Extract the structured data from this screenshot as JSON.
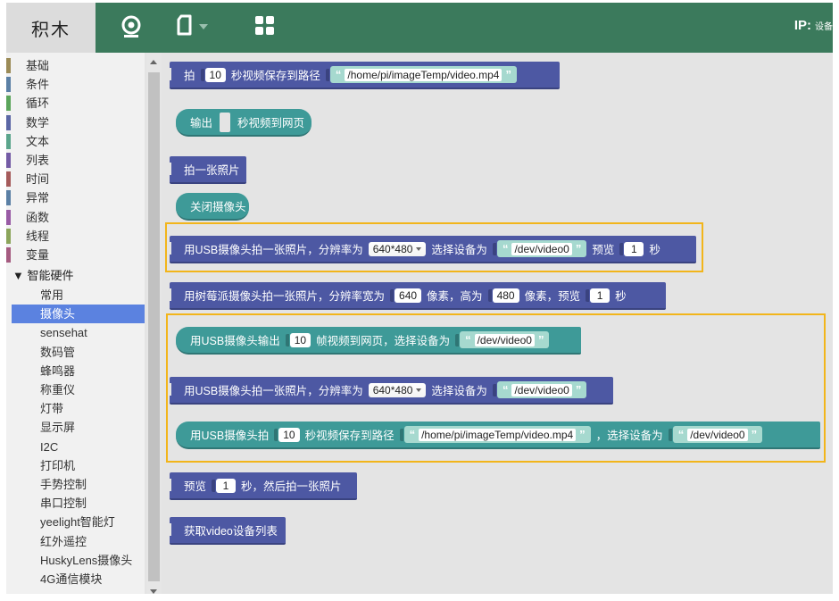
{
  "header": {
    "brand": "积木",
    "ip_label": "IP:",
    "ip_value": "设备",
    "icons": [
      "webcam-icon",
      "file-icon",
      "dropdown-caret-icon",
      "grid-icon"
    ]
  },
  "sidebar": {
    "categories": [
      {
        "label": "基础",
        "color": "#9b8b57"
      },
      {
        "label": "条件",
        "color": "#5b80a5"
      },
      {
        "label": "循环",
        "color": "#5ba55b"
      },
      {
        "label": "数学",
        "color": "#5b67a5"
      },
      {
        "label": "文本",
        "color": "#5ba58c"
      },
      {
        "label": "列表",
        "color": "#745ba5"
      },
      {
        "label": "时间",
        "color": "#a55b5b"
      },
      {
        "label": "异常",
        "color": "#5b80a5"
      },
      {
        "label": "函数",
        "color": "#995ba5"
      },
      {
        "label": "线程",
        "color": "#8ca55b"
      },
      {
        "label": "变量",
        "color": "#a55b80"
      }
    ],
    "group_label": "▼ 智能硬件",
    "subcategories": [
      "常用",
      "摄像头",
      "sensehat",
      "数码管",
      "蜂鸣器",
      "称重仪",
      "灯带",
      "显示屏",
      "I2C",
      "打印机",
      "手势控制",
      "串口控制",
      "yeelight智能灯",
      "红外遥控",
      "HuskyLens摄像头",
      "4G通信模块"
    ],
    "active_sub": "摄像头"
  },
  "blocks": {
    "b1": {
      "t1": "拍",
      "n1": "10",
      "t2": "秒视频保存到路径",
      "s1": "/home/pi/imageTemp/video.mp4"
    },
    "b2": {
      "t1": "输出",
      "t2": "秒视频到网页"
    },
    "b3": {
      "t1": "拍一张照片"
    },
    "b4": {
      "t1": "关闭摄像头"
    },
    "b5": {
      "t1": "用USB摄像头拍一张照片，分辨率为",
      "d1": "640*480",
      "t2": "选择设备为",
      "s1": "/dev/video0",
      "t3": "预览",
      "n1": "1",
      "t4": "秒"
    },
    "b6": {
      "t1": "用树莓派摄像头拍一张照片，分辨率宽为",
      "n1": "640",
      "t2": "像素，高为",
      "n2": "480",
      "t3": "像素，预览",
      "n3": "1",
      "t4": "秒"
    },
    "b7": {
      "t1": "用USB摄像头输出",
      "n1": "10",
      "t2": "帧视频到网页，选择设备为",
      "s1": "/dev/video0"
    },
    "b8": {
      "t1": "用USB摄像头拍一张照片，分辨率为",
      "d1": "640*480",
      "t2": "选择设备为",
      "s1": "/dev/video0"
    },
    "b9": {
      "t1": "用USB摄像头拍",
      "n1": "10",
      "t2": "秒视频保存到路径",
      "s1": "/home/pi/imageTemp/video.mp4",
      "t3": "，选择设备为",
      "s2": "/dev/video0"
    },
    "b10": {
      "t1": "预览",
      "n1": "1",
      "t2": "秒，然后拍一张照片"
    },
    "b11": {
      "t1": "获取video设备列表"
    }
  },
  "quote_open": "“",
  "quote_close": "”"
}
